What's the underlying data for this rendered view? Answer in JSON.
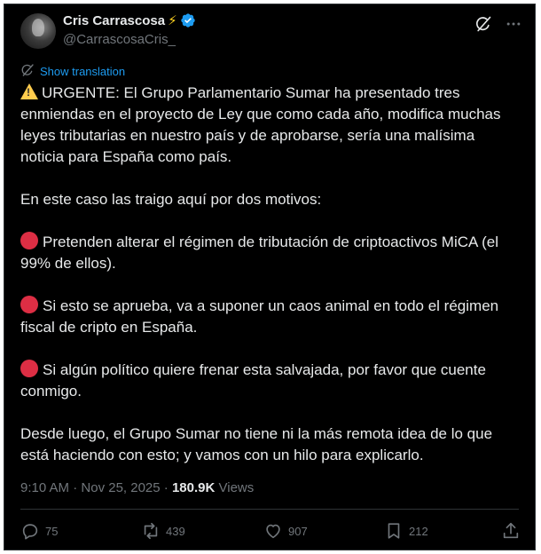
{
  "author": {
    "display_name": "Cris Carrascosa",
    "name_emoji": "⚡",
    "handle": "@CarrascosaCris_",
    "verified_icon": "verified-badge-icon"
  },
  "top_actions": {
    "grok_icon": "grok-icon",
    "more_icon": "more-icon"
  },
  "translation": {
    "icon": "translate-icon",
    "label": "Show translation"
  },
  "tweet": {
    "lead_icon": "warning-icon",
    "paragraph_1": "URGENTE: El Grupo Parlamentario Sumar ha presentado tres enmiendas en el proyecto de Ley que como cada año, modifica muchas leyes tributarias en nuestro país y de aprobarse, sería una malísima noticia para España como país.",
    "paragraph_2": "En este caso las traigo aquí por dos motivos:",
    "bullet_icon": "red-circle-icon",
    "bullet_1": "Pretenden alterar el régimen de tributación de criptoactivos MiCA (el 99% de ellos).",
    "bullet_2": "Si esto se aprueba, va a suponer un caos animal en todo el régimen fiscal de cripto en España.",
    "bullet_3": "Si algún político quiere frenar esta salvajada, por favor que cuente conmigo.",
    "paragraph_3": "Desde luego, el Grupo Sumar no tiene ni la más remota idea de lo que está haciendo con esto; y vamos con un hilo para explicarlo."
  },
  "meta": {
    "time": "9:10 AM",
    "separator": " · ",
    "date": "Nov 25, 2025",
    "separator2": " · ",
    "views_count": "180.9K",
    "views_label": " Views"
  },
  "actions": {
    "reply_count": "75",
    "repost_count": "439",
    "like_count": "907",
    "bookmark_count": "212"
  },
  "colors": {
    "background": "#000000",
    "text": "#e7e9ea",
    "muted": "#71767b",
    "accent": "#1d9bf0",
    "emoji_bolt": "#ffd21f",
    "red_circle": "#dd2e44"
  }
}
